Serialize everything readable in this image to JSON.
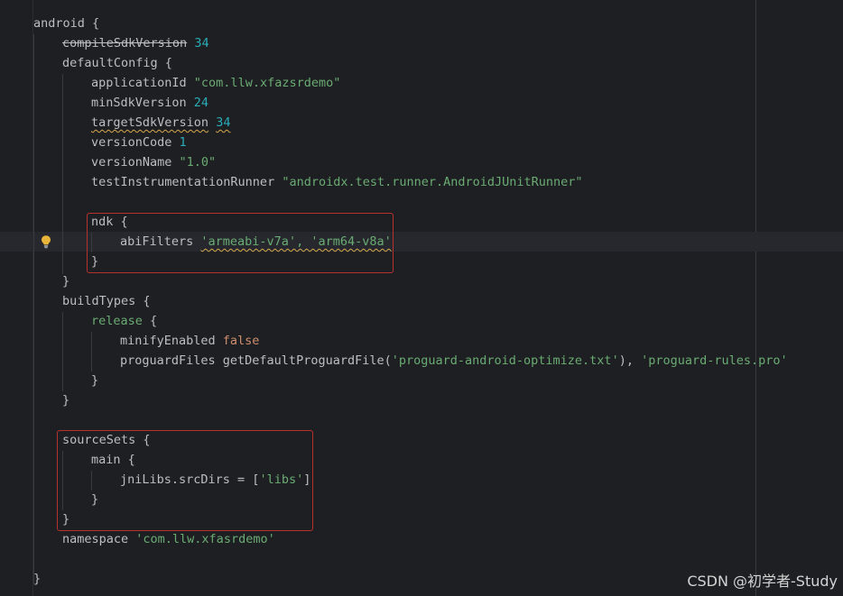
{
  "code": {
    "l1": {
      "a": "android {"
    },
    "l2": {
      "a": "compileSdkVersion",
      "b": " ",
      "c": "34"
    },
    "l3": {
      "a": "defaultConfig {"
    },
    "l4": {
      "a": "applicationId ",
      "b": "\"com.llw.xfazsrdemo\""
    },
    "l5": {
      "a": "minSdkVersion ",
      "b": "24"
    },
    "l6": {
      "a": "targetSdkVersion",
      "b": " ",
      "c": "34"
    },
    "l7": {
      "a": "versionCode ",
      "b": "1"
    },
    "l8": {
      "a": "versionName ",
      "b": "\"1.0\""
    },
    "l9": {
      "a": "testInstrumentationRunner ",
      "b": "\"androidx.test.runner.AndroidJUnitRunner\""
    },
    "l10": {
      "a": "ndk {"
    },
    "l11": {
      "a": "abiFilters ",
      "b": "'armeabi-v7a', 'arm64-v8a'"
    },
    "l12": {
      "a": "}"
    },
    "l13": {
      "a": "}"
    },
    "l14": {
      "a": "buildTypes {"
    },
    "l15": {
      "a": "release",
      "b": " {"
    },
    "l16": {
      "a": "minifyEnabled ",
      "b": "false"
    },
    "l17": {
      "a": "proguardFiles getDefaultProguardFile(",
      "b": "'proguard-android-optimize.txt'",
      "c": "), ",
      "d": "'proguard-rules.pro'"
    },
    "l18": {
      "a": "}"
    },
    "l19": {
      "a": "}"
    },
    "l20": {
      "a": "sourceSets {"
    },
    "l21": {
      "a": "main {"
    },
    "l22": {
      "a": "jniLibs.srcDirs = [",
      "b": "'libs'",
      "c": "]"
    },
    "l23": {
      "a": "}"
    },
    "l24": {
      "a": "}"
    },
    "l25": {
      "a": "namespace ",
      "b": "'com.llw.xfasrdemo'"
    },
    "l26": {
      "a": "}"
    }
  },
  "colors": {
    "background": "#1e1f22",
    "keyword": "#cf8e6d",
    "number": "#2aacb8",
    "string": "#6aab73",
    "text": "#bcbec4",
    "highlight_box": "#b7322f"
  },
  "icons": {
    "intention": "lightbulb-icon"
  },
  "watermark": "CSDN @初学者-Study"
}
